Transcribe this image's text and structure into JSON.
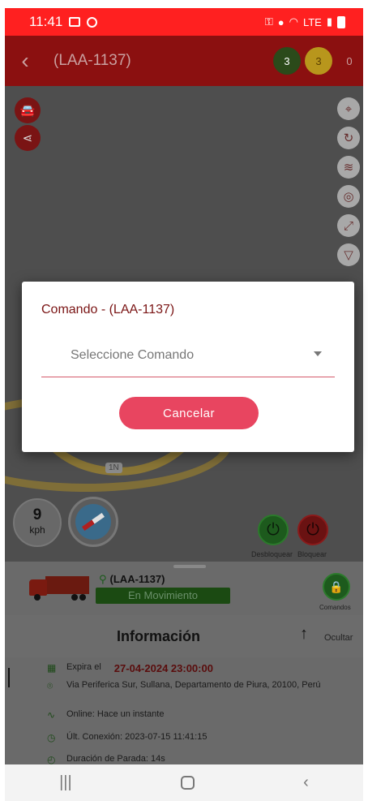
{
  "status_bar": {
    "time": "11:41",
    "right_icons": [
      "key-icon",
      "location-icon",
      "wifi-icon",
      "signal-icon",
      "battery-icon"
    ],
    "lte_label": "LTE"
  },
  "app_bar": {
    "title": "(LAA-1137)",
    "counts": [
      "3",
      "3",
      "0"
    ]
  },
  "map": {
    "route_label": "1N",
    "speed": {
      "value": "9",
      "unit": "kph"
    },
    "unlock_label": "Desbloquear",
    "lock_label": "Bloquear"
  },
  "vehicle_card": {
    "plate": "(LAA-1137)",
    "status": "En Movimiento",
    "commands_label": "Comandos"
  },
  "info": {
    "title": "Información",
    "hide_label": "Ocultar",
    "expires_label": "Expira el",
    "expires_date": "27-04-2024 23:00:00",
    "address": "Via Periferica Sur, Sullana, Departamento de Piura, 20100, Perú",
    "online": "Online: Hace un instante",
    "last_connection": "Últ. Conexión: 2023-07-15 11:41:15",
    "stop_duration": "Duración de Parada: 14s"
  },
  "dialog": {
    "title": "Comando - (LAA-1137)",
    "select_placeholder": "Seleccione Comando",
    "cancel_label": "Cancelar"
  },
  "colors": {
    "status_bar": "#ff2020",
    "app_bar": "#8b1010",
    "cancel_button": "#e84560",
    "accent": "#7a1414"
  }
}
